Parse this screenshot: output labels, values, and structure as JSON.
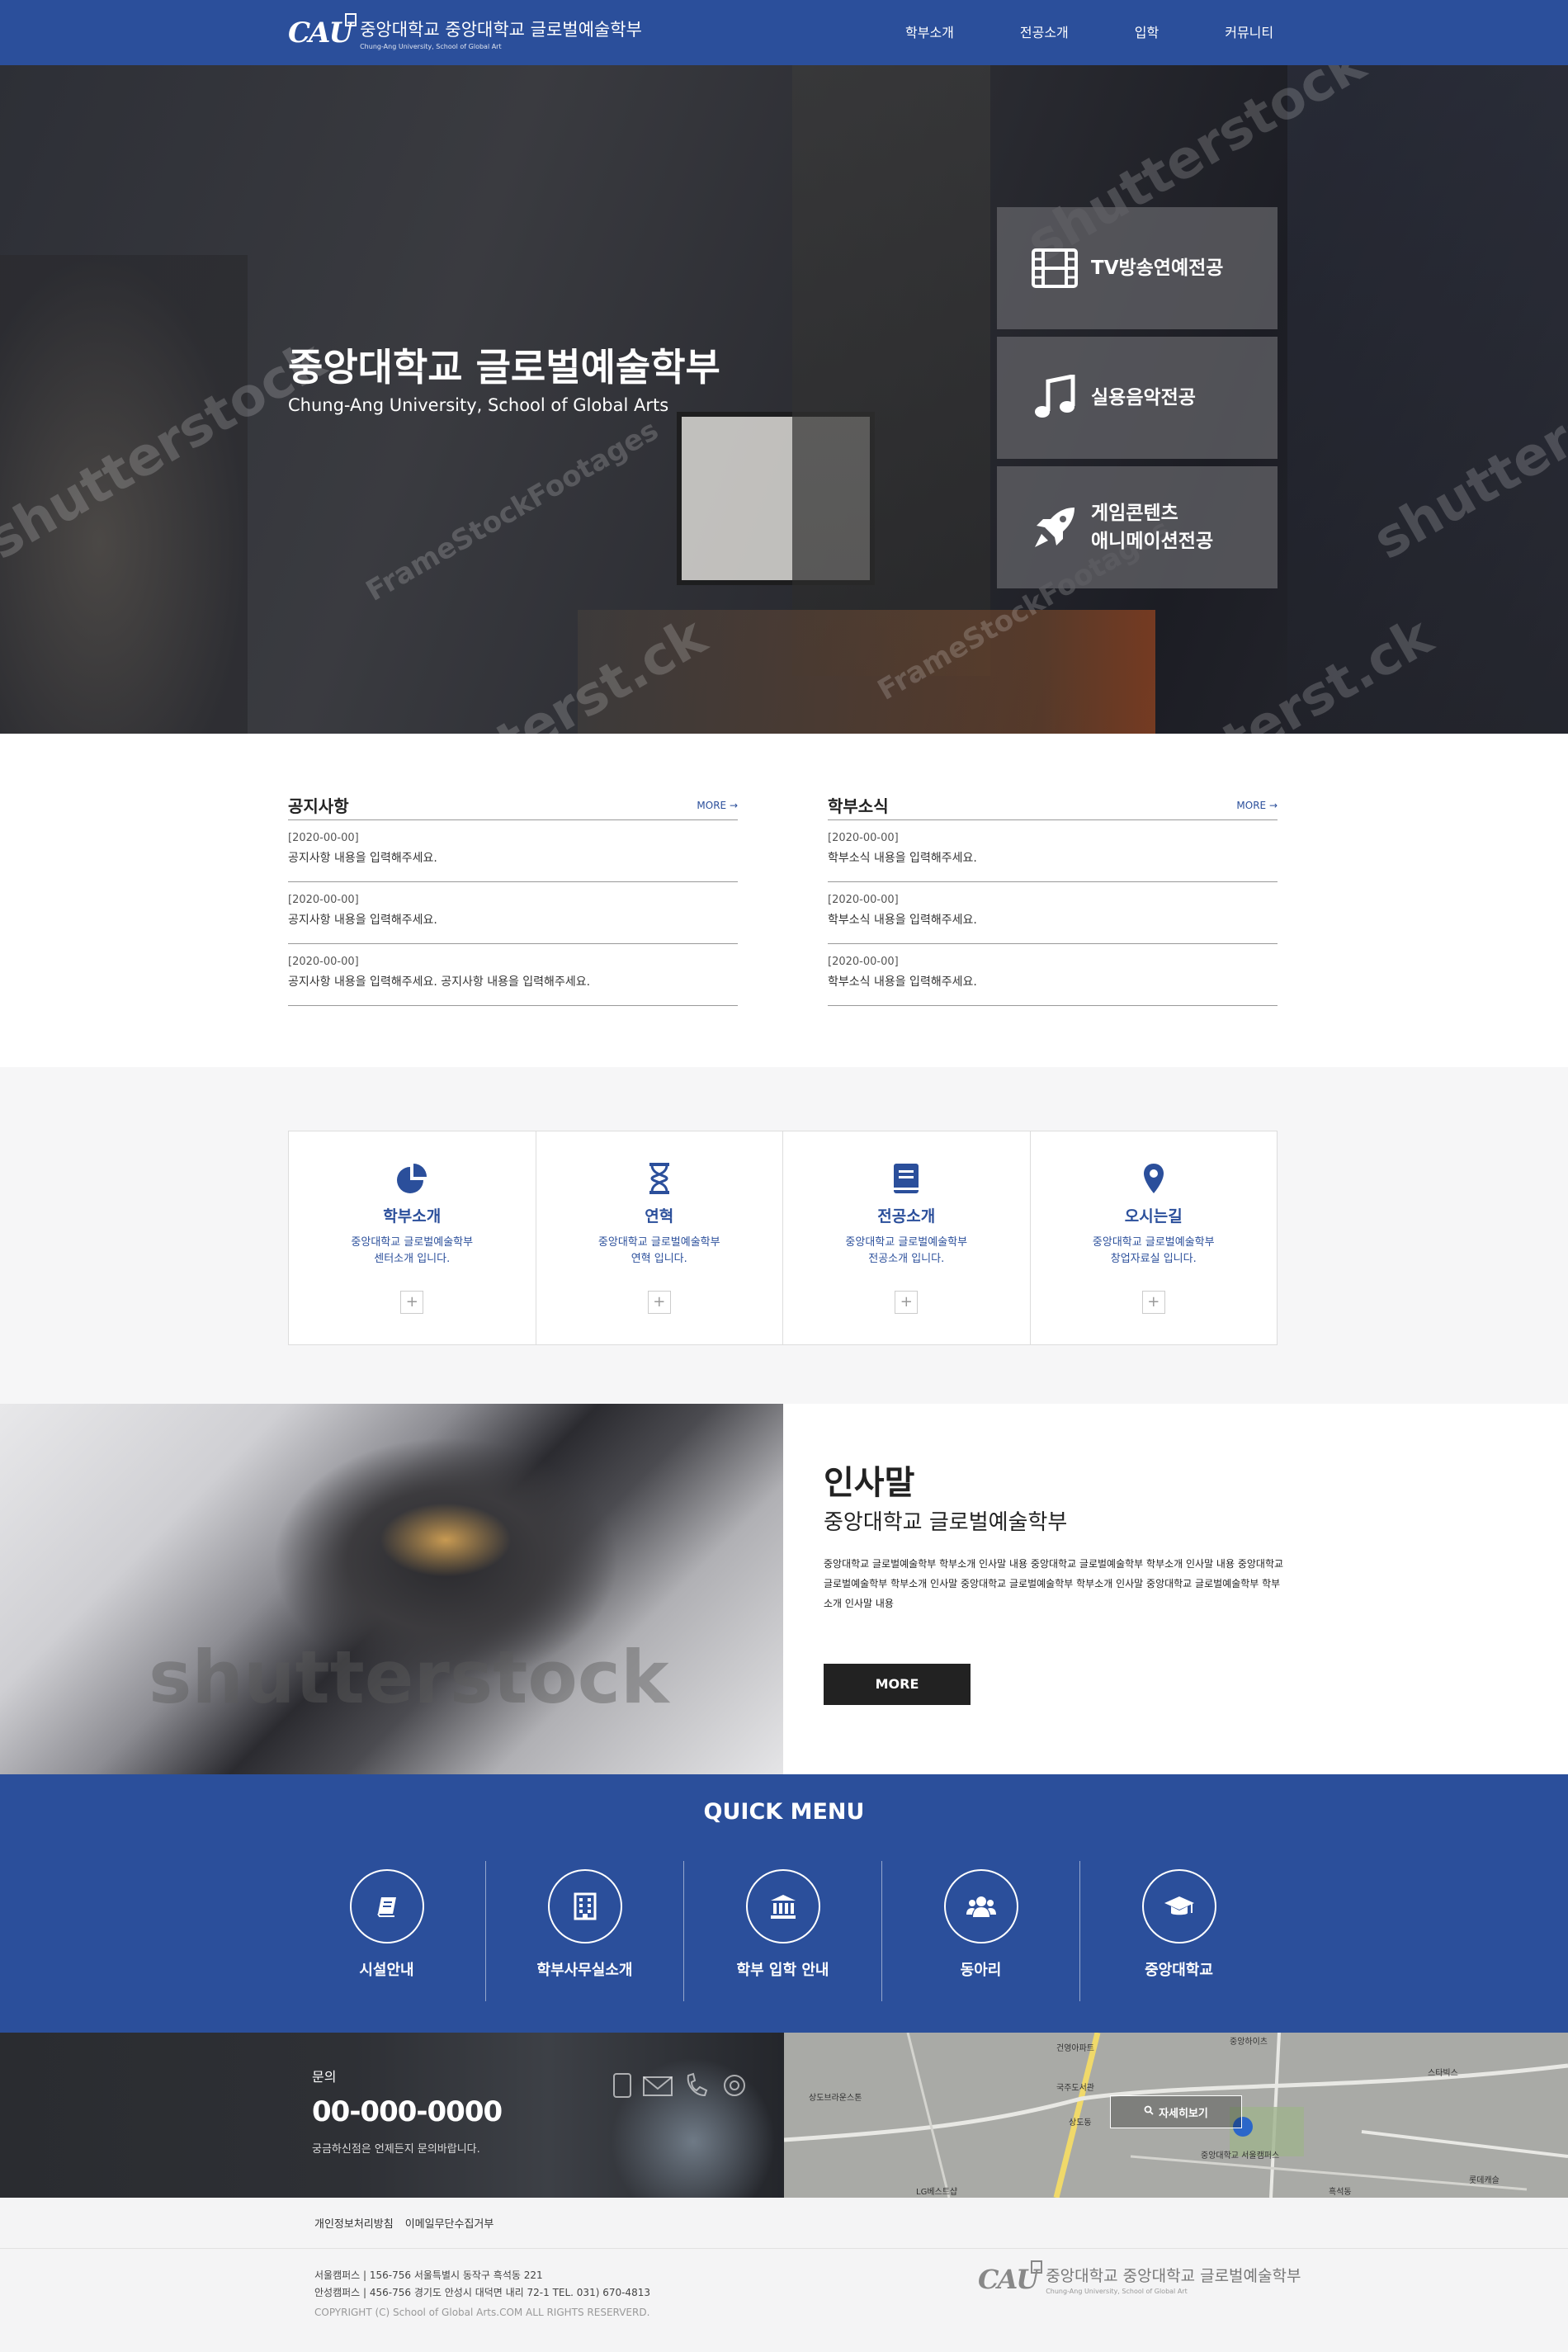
{
  "header": {
    "logo_mark": "CAU",
    "logo_title": "중앙대학교 중앙대학교 글로벌예술학부",
    "logo_sub": "Chung-Ang University, School of Global Art",
    "nav": [
      "학부소개",
      "전공소개",
      "입학",
      "커뮤니티"
    ]
  },
  "hero": {
    "title": "중앙대학교 글로벌예술학부",
    "subtitle": "Chung-Ang University, School of Global Arts",
    "watermarks": [
      "shutterstock",
      "FrameStockFootages",
      "shutterst.ck"
    ],
    "majors": [
      {
        "icon": "film-icon",
        "label": "TV방송연예전공"
      },
      {
        "icon": "music-note-icon",
        "label": "실용음악전공"
      },
      {
        "icon": "rocket-icon",
        "label": "게임콘텐츠\n애니메이션전공"
      }
    ]
  },
  "boards": [
    {
      "title": "공지사항",
      "more": "MORE →",
      "items": [
        {
          "date": "[2020-00-00]",
          "text": "공지사항 내용을 입력해주세요."
        },
        {
          "date": "[2020-00-00]",
          "text": "공지사항 내용을 입력해주세요."
        },
        {
          "date": "[2020-00-00]",
          "text": "공지사항 내용을 입력해주세요. 공지사항 내용을 입력해주세요."
        }
      ]
    },
    {
      "title": "학부소식",
      "more": "MORE →",
      "items": [
        {
          "date": "[2020-00-00]",
          "text": "학부소식 내용을 입력해주세요."
        },
        {
          "date": "[2020-00-00]",
          "text": "학부소식 내용을 입력해주세요."
        },
        {
          "date": "[2020-00-00]",
          "text": "학부소식 내용을 입력해주세요."
        }
      ]
    }
  ],
  "features": [
    {
      "icon": "pie-chart-icon",
      "title": "학부소개",
      "desc": "중앙대학교 글로벌예술학부\n센터소개 입니다.",
      "plus": "+"
    },
    {
      "icon": "hourglass-icon",
      "title": "연혁",
      "desc": "중앙대학교 글로벌예술학부\n연혁 입니다.",
      "plus": "+"
    },
    {
      "icon": "book-icon",
      "title": "전공소개",
      "desc": "중앙대학교 글로벌예술학부\n전공소개 입니다.",
      "plus": "+"
    },
    {
      "icon": "map-pin-icon",
      "title": "오시는길",
      "desc": "중앙대학교 글로벌예술학부\n창업자료실 입니다.",
      "plus": "+"
    }
  ],
  "greeting": {
    "watermark": "shutterstock",
    "title": "인사말",
    "subtitle": "중앙대학교 글로벌예술학부",
    "text": "중앙대학교 글로벌예술학부 학부소개 인사말 내용 중앙대학교 글로벌예술학부 학부소개 인사말 내용 중앙대학교 글로벌예술학부 학부소개 인사말 중앙대학교 글로벌예술학부 학부소개 인사말 중앙대학교 글로벌예술학부 학부소개 인사말 내용",
    "more": "MORE"
  },
  "quick": {
    "title": "QUICK MENU",
    "items": [
      {
        "icon": "book-open-icon",
        "label": "시설안내"
      },
      {
        "icon": "building-icon",
        "label": "학부사무실소개"
      },
      {
        "icon": "institution-icon",
        "label": "학부 입학 안내"
      },
      {
        "icon": "users-icon",
        "label": "동아리"
      },
      {
        "icon": "graduation-cap-icon",
        "label": "중앙대학교"
      }
    ]
  },
  "contact": {
    "label": "문의",
    "phone": "00-000-0000",
    "desc": "궁금하신점은 언제든지 문의바랍니다."
  },
  "map": {
    "button": "자세히보기",
    "labels": [
      "중앙하이츠",
      "건영아파트",
      "상도브라운스톤",
      "상도2차",
      "스타빅스",
      "국주도서관",
      "상도동",
      "중앙대학교 서울캠퍼스",
      "롯데캐슬",
      "LG베스트샵",
      "흑석동"
    ]
  },
  "footer": {
    "links": [
      "개인정보처리방침",
      "이메일무단수집거부"
    ],
    "address": "서울캠퍼스  |  156-756 서울특별시 동작구 흑석동 221\n안성캠퍼스  |  456-756 경기도 안성시 대덕면 내리 72-1 TEL. 031) 670-4813",
    "copyright": "COPYRIGHT (C) School of Global Arts.COM ALL RIGHTS RESERVERD.",
    "logo_mark": "CAU",
    "logo_title": "중앙대학교 중앙대학교 글로벌예술학부",
    "logo_sub": "Chung-Ang University, School of Global Art"
  },
  "colors": {
    "brand": "#2b4f9b",
    "dark": "#222222"
  }
}
